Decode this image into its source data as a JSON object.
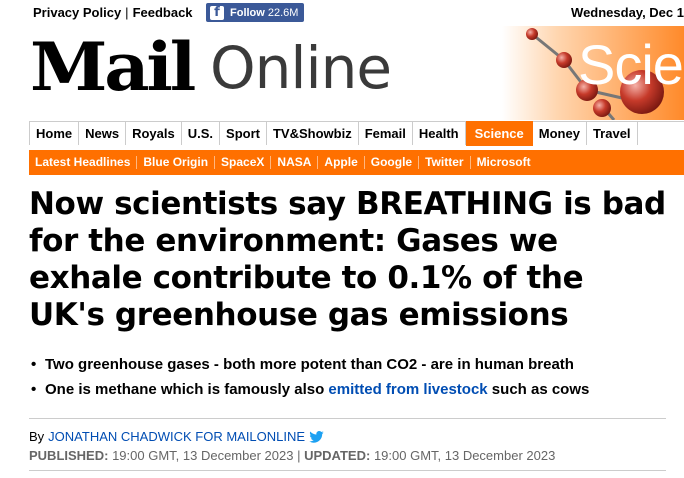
{
  "topbar": {
    "privacy": "Privacy Policy",
    "feedback": "Feedback",
    "separator": "|",
    "fb_icon": "f",
    "fb_label": "Follow",
    "fb_count": "22.6M",
    "date": "Wednesday, Dec 1"
  },
  "masthead": {
    "mail": "Mail",
    "online": "Online",
    "channel": "Scie"
  },
  "nav": {
    "items": [
      "Home",
      "News",
      "Royals",
      "U.S.",
      "Sport",
      "TV&Showbiz",
      "Femail",
      "Health",
      "Science",
      "Money",
      "Travel"
    ],
    "active": "Science"
  },
  "subnav": {
    "items": [
      "Latest Headlines",
      "Blue Origin",
      "SpaceX",
      "NASA",
      "Apple",
      "Google",
      "Twitter",
      "Microsoft"
    ]
  },
  "article": {
    "headline": "Now scientists say BREATHING is bad for the environment: Gases we exhale contribute to 0.1% of the UK's greenhouse gas emissions",
    "bullet1": "Two greenhouse gases - both more potent than CO2 - are in human breath",
    "bullet2_pre": "One is methane which is famously also ",
    "bullet2_link": "emitted from livestock",
    "bullet2_post": " such as cows",
    "by": "By",
    "author": "JONATHAN CHADWICK FOR MAILONLINE",
    "published_label": "PUBLISHED:",
    "published": "19:00 GMT, 13 December 2023",
    "sep": "|",
    "updated_label": "UPDATED:",
    "updated": "19:00 GMT, 13 December 2023"
  },
  "colors": {
    "accent": "#ff7000",
    "link": "#004db3",
    "facebook": "#3b5998"
  },
  "icons": [
    "facebook-icon",
    "twitter-icon"
  ]
}
